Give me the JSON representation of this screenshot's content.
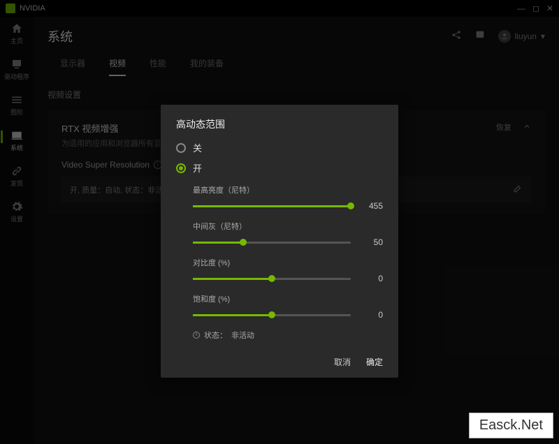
{
  "app_name": "NVIDIA",
  "header": {
    "title": "系统",
    "username": "liuyun"
  },
  "sidebar": {
    "items": [
      {
        "label": "主页"
      },
      {
        "label": "驱动程序"
      },
      {
        "label": "图形"
      },
      {
        "label": "系统"
      },
      {
        "label": "发现"
      },
      {
        "label": "设置"
      }
    ]
  },
  "tabs": {
    "items": [
      {
        "label": "显示器"
      },
      {
        "label": "视频"
      },
      {
        "label": "性能"
      },
      {
        "label": "我的装备"
      }
    ],
    "active_index": 1
  },
  "section_title": "视频设置",
  "card": {
    "title": "RTX 视频增强",
    "subtitle": "为适用的应用和浏览器所有显示器的 VSR 和 HDR 设置",
    "restore": "恢复",
    "row_label": "Video Super Resolution",
    "sub_text": "开, 质量：自动, 状态：非活动"
  },
  "dialog": {
    "title": "高动态范围",
    "opt_off": "关",
    "opt_on": "开",
    "sliders": [
      {
        "label": "最高亮度（尼特）",
        "value": 455,
        "pct": 100
      },
      {
        "label": "中间灰（尼特）",
        "value": 50,
        "pct": 32
      },
      {
        "label": "对比度 (%)",
        "value": 0,
        "pct": 50
      },
      {
        "label": "饱和度 (%)",
        "value": 0,
        "pct": 50
      }
    ],
    "status_label": "状态：",
    "status_value": "非活动",
    "cancel": "取消",
    "ok": "确定"
  },
  "watermark": "Easck.Net"
}
